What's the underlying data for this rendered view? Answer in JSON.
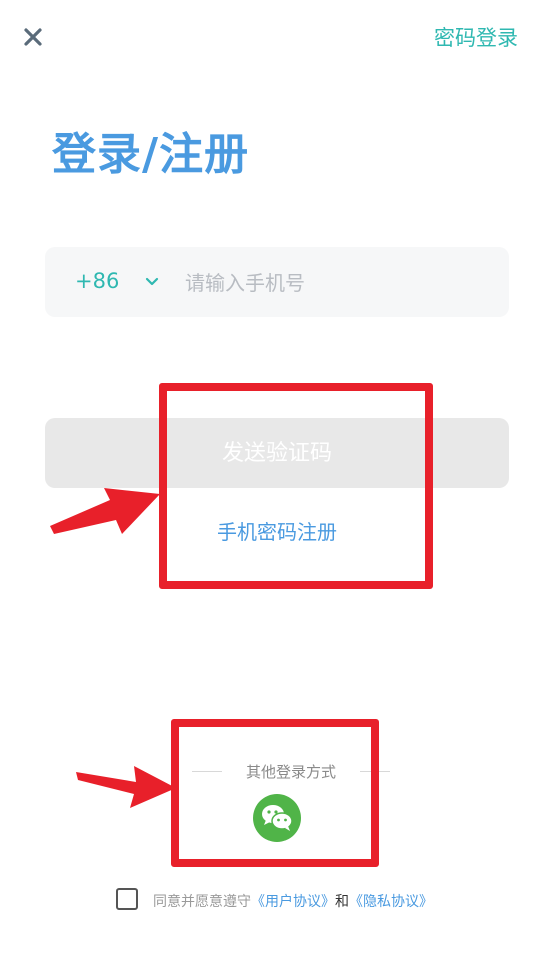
{
  "header": {
    "close_icon": "close-icon",
    "password_login_label": "密码登录"
  },
  "title": "登录/注册",
  "phone": {
    "country_code": "+86",
    "placeholder": "请输入手机号",
    "value": ""
  },
  "send_code_label": "发送验证码",
  "password_register_label": "手机密码注册",
  "other_login": {
    "label": "其他登录方式",
    "wechat_icon": "wechat-icon"
  },
  "agreement": {
    "prefix": "同意并愿意遵守",
    "user_agreement": "《用户协议》",
    "and": "和",
    "privacy_agreement": "《隐私协议》"
  },
  "colors": {
    "accent_teal": "#2fb8b1",
    "accent_blue": "#4a9ae0",
    "annotation_red": "#e8202a",
    "wechat_green": "#50b448"
  }
}
